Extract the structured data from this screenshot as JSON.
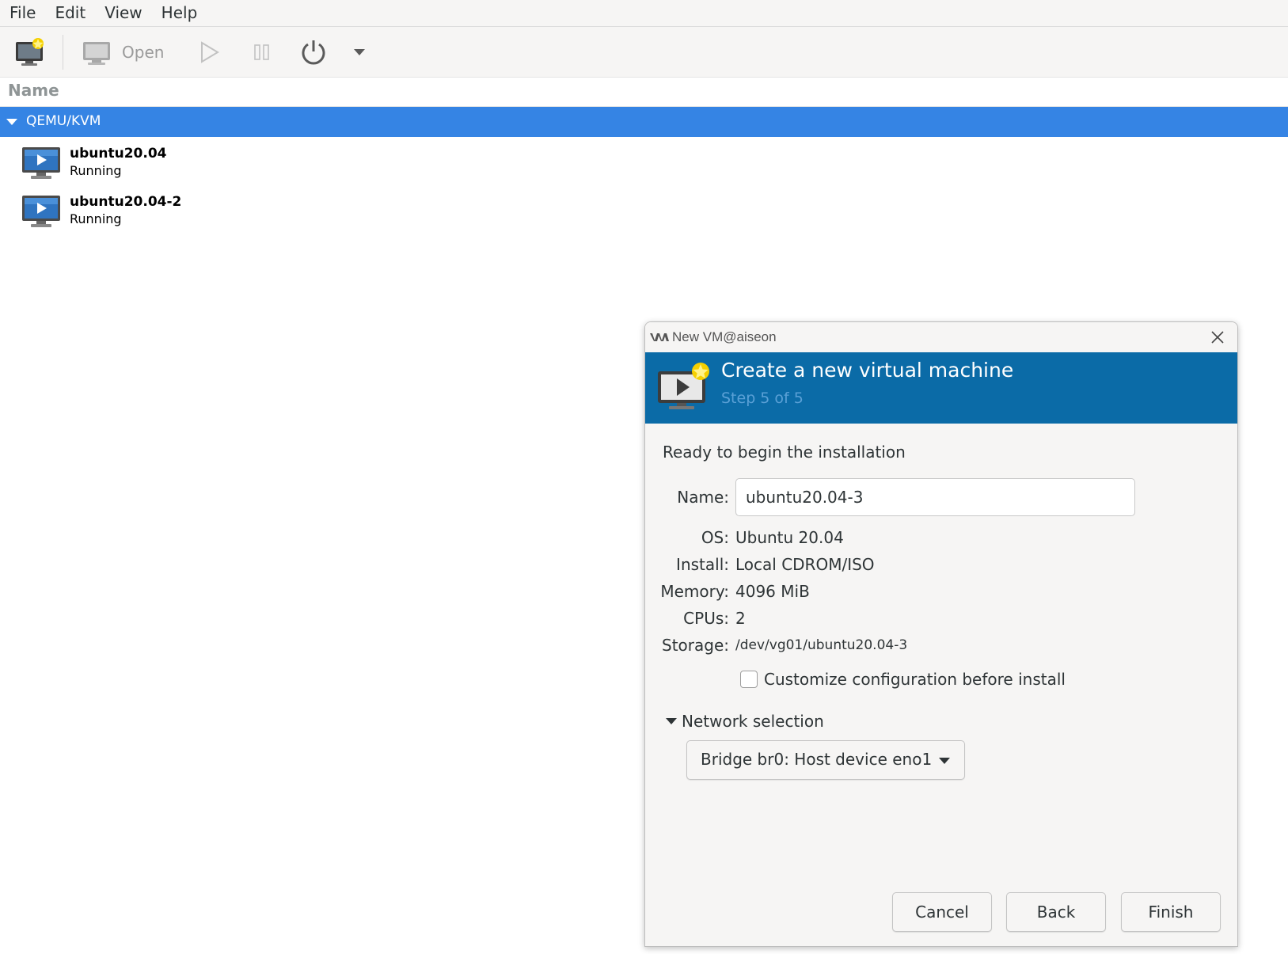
{
  "menubar": {
    "items": [
      "File",
      "Edit",
      "View",
      "Help"
    ]
  },
  "toolbar": {
    "open_label": "Open"
  },
  "list": {
    "column_header": "Name",
    "group_label": "QEMU/KVM",
    "vms": [
      {
        "name": "ubuntu20.04",
        "status": "Running"
      },
      {
        "name": "ubuntu20.04-2",
        "status": "Running"
      }
    ]
  },
  "dialog": {
    "title": "New VM@aiseon",
    "banner_title": "Create a new virtual machine",
    "banner_step": "Step 5 of 5",
    "ready_text": "Ready to begin the installation",
    "fields": {
      "name_label": "Name:",
      "name_value": "ubuntu20.04-3",
      "os_label": "OS:",
      "os_value": "Ubuntu 20.04",
      "install_label": "Install:",
      "install_value": "Local CDROM/ISO",
      "memory_label": "Memory:",
      "memory_value": "4096 MiB",
      "cpus_label": "CPUs:",
      "cpus_value": "2",
      "storage_label": "Storage:",
      "storage_value": "/dev/vg01/ubuntu20.04-3"
    },
    "customize_label": "Customize configuration before install",
    "customize_checked": false,
    "network_section_label": "Network selection",
    "network_selected": "Bridge br0: Host device eno1",
    "buttons": {
      "cancel": "Cancel",
      "back": "Back",
      "finish": "Finish"
    }
  },
  "colors": {
    "selection_blue": "#3584e4",
    "banner_blue": "#0b6ba7",
    "step_text": "#5aa0d6"
  }
}
